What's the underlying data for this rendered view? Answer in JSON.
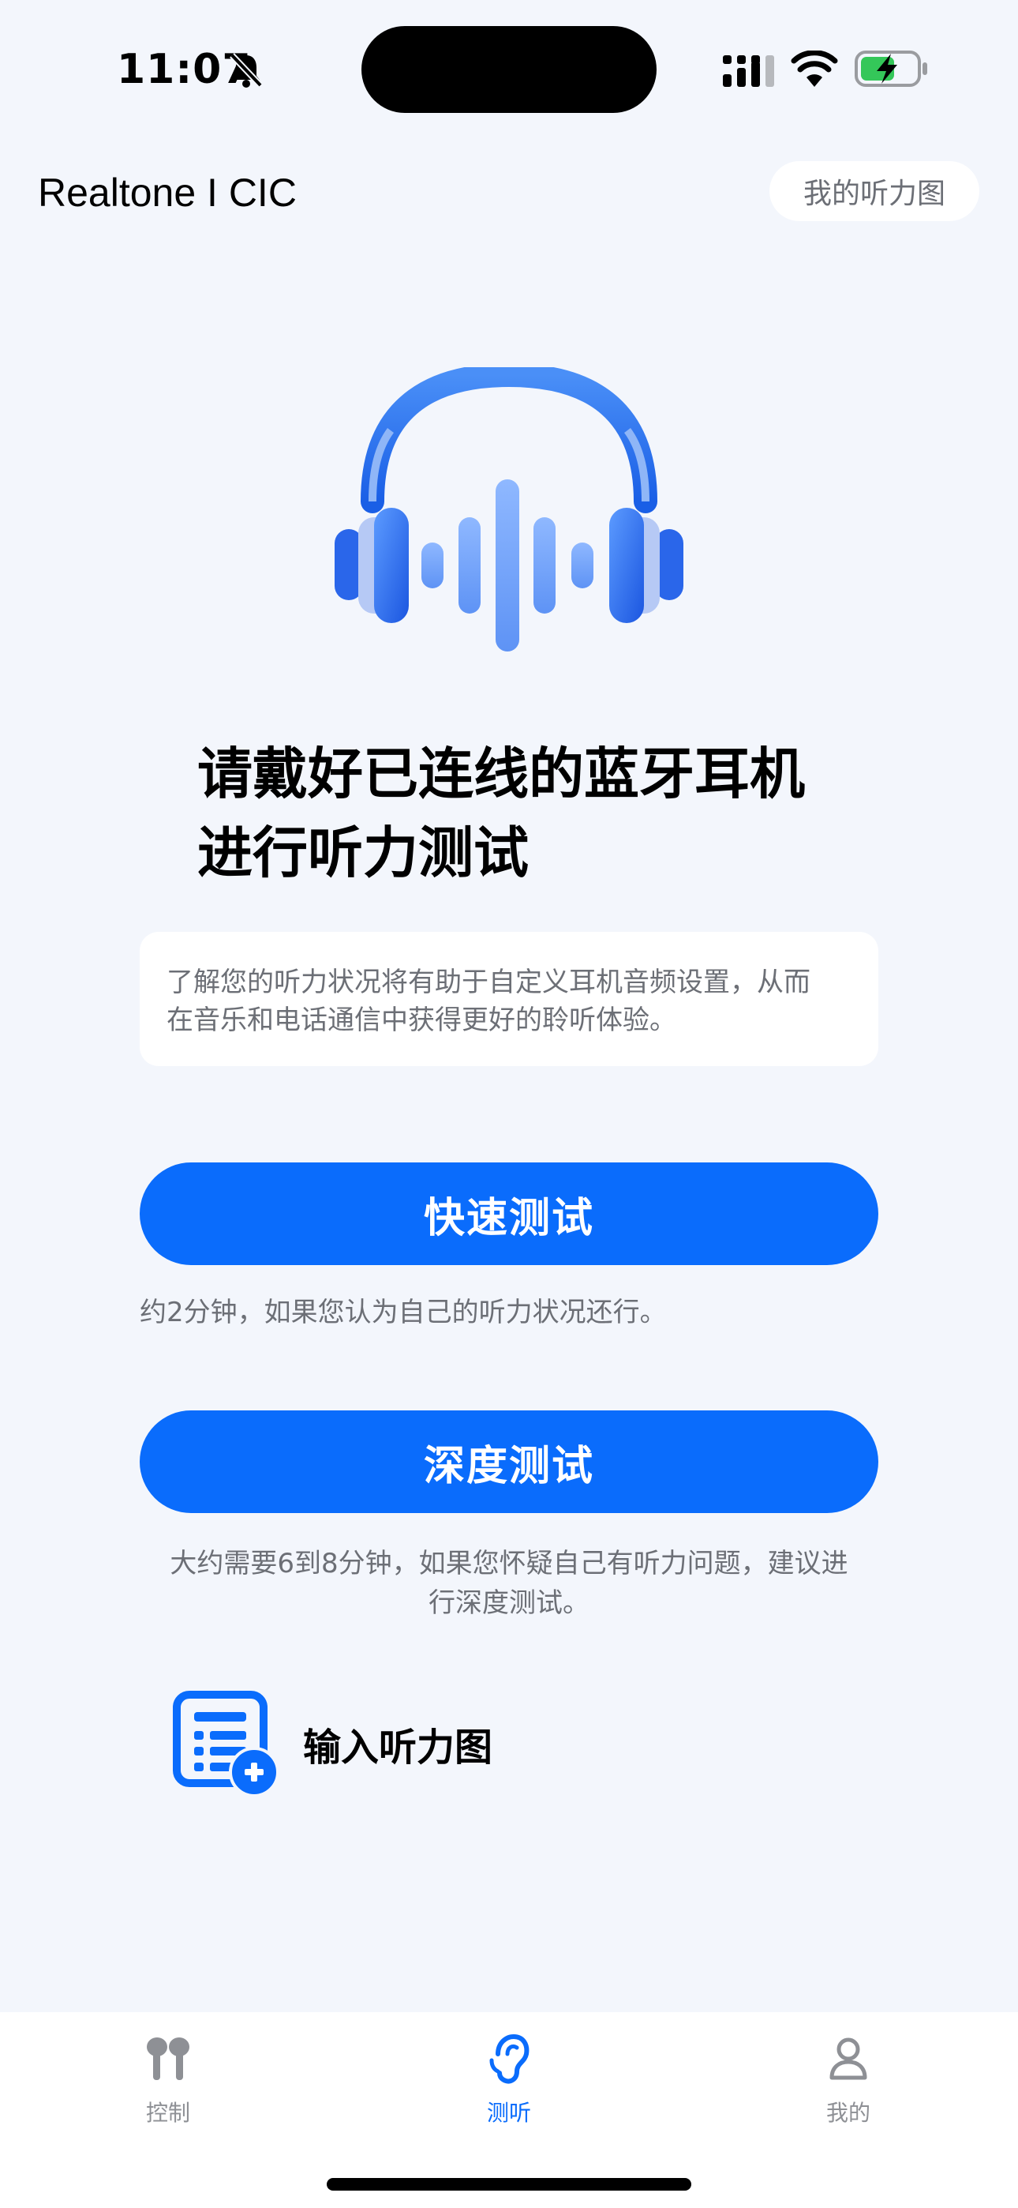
{
  "status_bar": {
    "time": "11:07",
    "battery": "charging"
  },
  "header": {
    "title": "Realtone I CIC",
    "audiogram_button": "我的听力图"
  },
  "hero": {
    "icon": "headphones-soundwave-icon",
    "line1": "请戴好已连线的蓝牙耳机",
    "line2": "进行听力测试"
  },
  "intro": {
    "line1": "了解您的听力状况将有助于自定义耳机音频设置，从而",
    "line2": "在音乐和电话通信中获得更好的聆听体验。"
  },
  "quick_test": {
    "label": "快速测试",
    "description": "约2分钟，如果您认为自己的听力状况还行。"
  },
  "deep_test": {
    "label": "深度测试",
    "description_line1": "大约需要6到8分钟，如果您怀疑自己有听力问题，建议进",
    "description_line2": "行深度测试。"
  },
  "input_audiogram": {
    "label": "输入听力图",
    "icon": "list-add-icon"
  },
  "tab_bar": {
    "tabs": [
      {
        "label": "控制",
        "icon": "earbuds-icon",
        "active": false
      },
      {
        "label": "测听",
        "icon": "ear-icon",
        "active": true
      },
      {
        "label": "我的",
        "icon": "person-icon",
        "active": false
      }
    ]
  },
  "colors": {
    "accent": "#0a6cfc",
    "background": "#f3f6fc",
    "muted_text": "#6c6f76"
  }
}
